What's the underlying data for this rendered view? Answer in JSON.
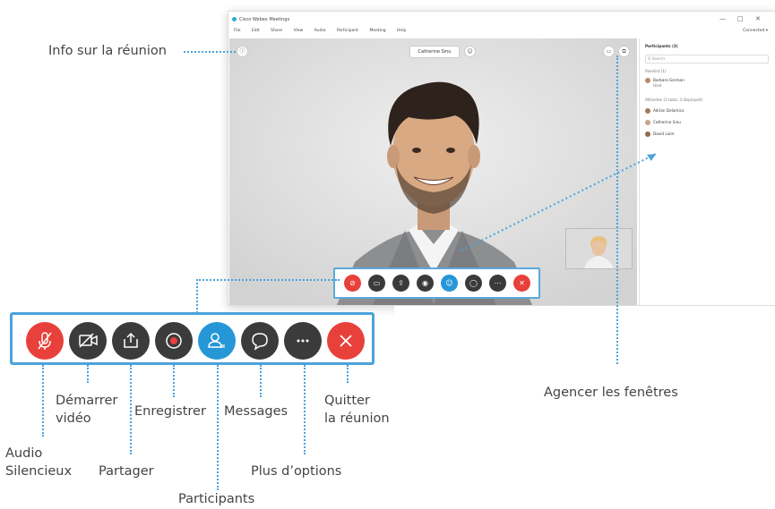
{
  "window": {
    "title": "Cisco Webex Meetings",
    "menu": [
      "File",
      "Edit",
      "Share",
      "View",
      "Audio",
      "Participant",
      "Meeting",
      "Help"
    ],
    "connection": "Connected ▾",
    "controls": [
      "—",
      "□",
      "✕"
    ]
  },
  "video": {
    "speaker_name": "Catherine Sinu"
  },
  "panel": {
    "title": "Participants (3)",
    "search_placeholder": "Q  Search",
    "panelist_header": "Panelist (1)",
    "panelist_name": "Barbara German",
    "panelist_role": "Host",
    "attendee_header": "Attendee (3 total, 3 displayed)",
    "attendees": [
      "Adrian Delamico",
      "Catherine Sinu",
      "David Liam"
    ]
  },
  "toolbar": {
    "icons": [
      "mic-muted-icon",
      "video-off-icon",
      "share-icon",
      "record-icon",
      "participants-icon",
      "chat-icon",
      "more-icon",
      "leave-icon"
    ],
    "colors": {
      "red": "#e8403a",
      "dark": "#3b3b3b",
      "blue": "#2597d7",
      "frame": "#4aa3dc"
    }
  },
  "callouts": {
    "meeting_info": "Info sur la réunion",
    "arrange_windows": "Agencer les fenêtres",
    "start_video_1": "Démarrer",
    "start_video_2": "vidéo",
    "record": "Enregistrer",
    "messages": "Messages",
    "quit_1": "Quitter",
    "quit_2": "la réunion",
    "audio_1": "Audio",
    "audio_2": "Silencieux",
    "share": "Partager",
    "more_options": "Plus d’options",
    "participants": "Participants"
  }
}
